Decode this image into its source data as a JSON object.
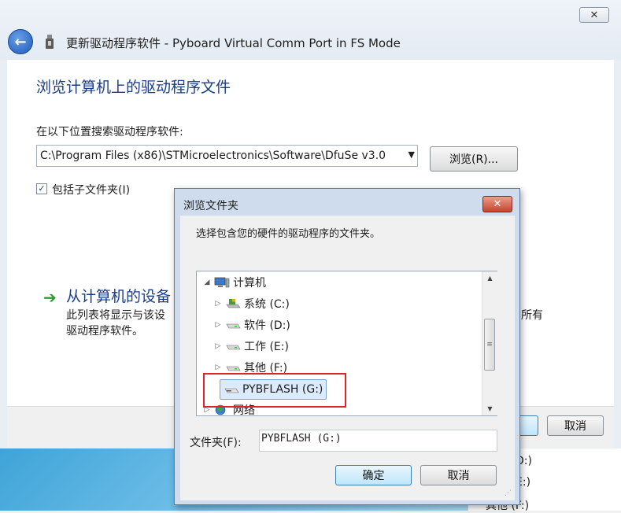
{
  "window": {
    "title": "更新驱动程序软件 - Pyboard Virtual Comm Port in FS Mode",
    "close_label": "✕",
    "back_label": "←"
  },
  "main": {
    "heading": "浏览计算机上的驱动程序文件",
    "search_label": "在以下位置搜索驱动程序软件:",
    "path_value": "C:\\Program Files (x86)\\STMicroelectronics\\Software\\DfuSe v3.0",
    "browse_label": "浏览(R)...",
    "include_subfolders_label": "包括子文件夹(I)",
    "include_subfolders_checked": true,
    "option_title": "从计算机的设备",
    "option_desc_line1": "此列表将显示与该设",
    "option_desc_line2": "驱动程序软件。",
    "option_desc_right": "所有"
  },
  "bottom": {
    "next_fragment": ")",
    "cancel_label": "取消"
  },
  "background_explorer": {
    "items": [
      "D:)",
      "E:)",
      "其他 (F:)"
    ]
  },
  "dialog": {
    "title": "浏览文件夹",
    "close_label": "✕",
    "instruction": "选择包含您的硬件的驱动程序的文件夹。",
    "tree": [
      {
        "label": "计算机",
        "icon": "computer-icon",
        "expander": "◢",
        "level": 0
      },
      {
        "label": "系统 (C:)",
        "icon": "system-drive-icon",
        "expander": "▷",
        "level": 1
      },
      {
        "label": "软件 (D:)",
        "icon": "drive-icon",
        "expander": "▷",
        "level": 1
      },
      {
        "label": "工作 (E:)",
        "icon": "drive-icon",
        "expander": "▷",
        "level": 1
      },
      {
        "label": "其他 (F:)",
        "icon": "drive-icon",
        "expander": "▷",
        "level": 1
      },
      {
        "label": "PYBFLASH (G:)",
        "icon": "removable-drive-icon",
        "expander": "",
        "level": 1,
        "selected": true
      },
      {
        "label": "网络",
        "icon": "network-icon",
        "expander": "▷",
        "level": 0
      }
    ],
    "folder_label": "文件夹(F):",
    "folder_value": "PYBFLASH (G:)",
    "ok_label": "确定",
    "cancel_label": "取消"
  },
  "colors": {
    "heading_blue": "#1a3d8a",
    "highlight_red": "#d9262c",
    "selection_bg": "#dcebfc"
  }
}
